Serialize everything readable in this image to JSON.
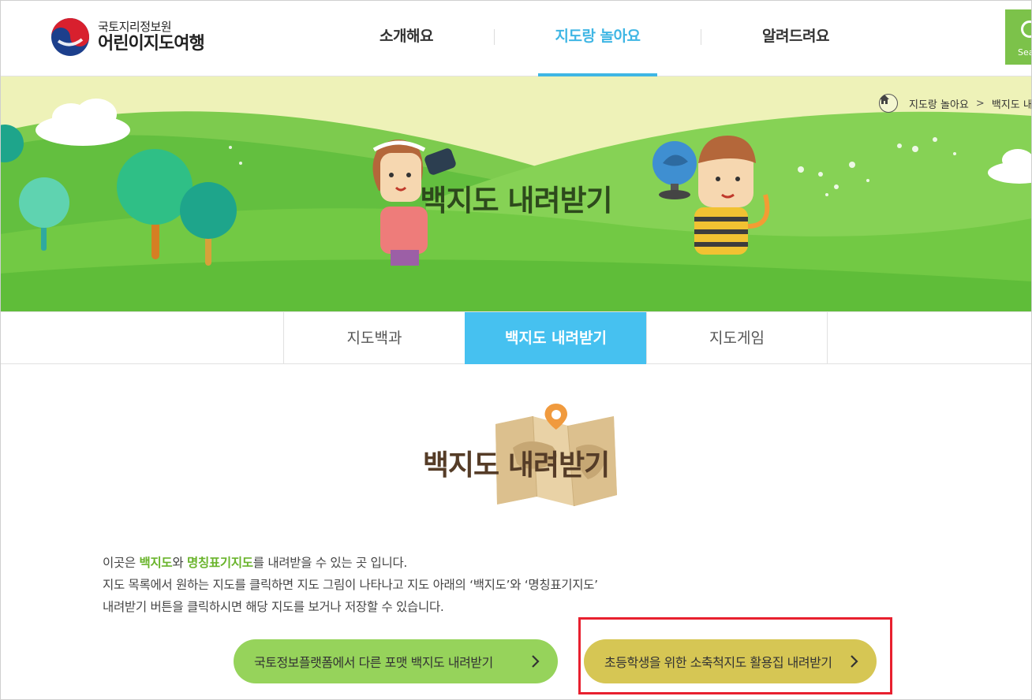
{
  "header": {
    "logo_org": "국토지리정보원",
    "logo_name": "어린이지도여행",
    "nav": [
      {
        "label": "소개해요",
        "active": false
      },
      {
        "label": "지도랑 놀아요",
        "active": true
      },
      {
        "label": "알려드려요",
        "active": false
      }
    ],
    "search_label": "Search"
  },
  "banner": {
    "title": "백지도 내려받기",
    "breadcrumb": [
      "지도랑 놀아요",
      "백지도 내려받기"
    ]
  },
  "subtabs": [
    {
      "label": "지도백과",
      "active": false
    },
    {
      "label": "백지도 내려받기",
      "active": true
    },
    {
      "label": "지도게임",
      "active": false
    }
  ],
  "content": {
    "title": "백지도 내려받기",
    "desc": {
      "line1_pre": "이곳은 ",
      "line1_hl1": "백지도",
      "line1_mid": "와 ",
      "line1_hl2": "명칭표기지도",
      "line1_post": "를 내려받을 수 있는 곳 입니다.",
      "line2": "지도 목록에서 원하는 지도를 클릭하면 지도 그림이 나타나고 지도 아래의 ‘백지도’와 ‘명칭표기지도’",
      "line3": "내려받기 버튼을 클릭하시면 해당 지도를 보거나 저장할 수 있습니다."
    },
    "buttons": [
      {
        "label": "국토정보플랫폼에서 다른 포맷 백지도 내려받기"
      },
      {
        "label": "초등학생을 위한 소축척지도 활용집 내려받기"
      }
    ]
  },
  "colors": {
    "accent_blue": "#3fb6e4",
    "tab_active": "#46c1f0",
    "green_button": "#96d35b",
    "yellow_button": "#d6c654",
    "highlight_red": "#e8202f",
    "search_green": "#7cc24a"
  }
}
